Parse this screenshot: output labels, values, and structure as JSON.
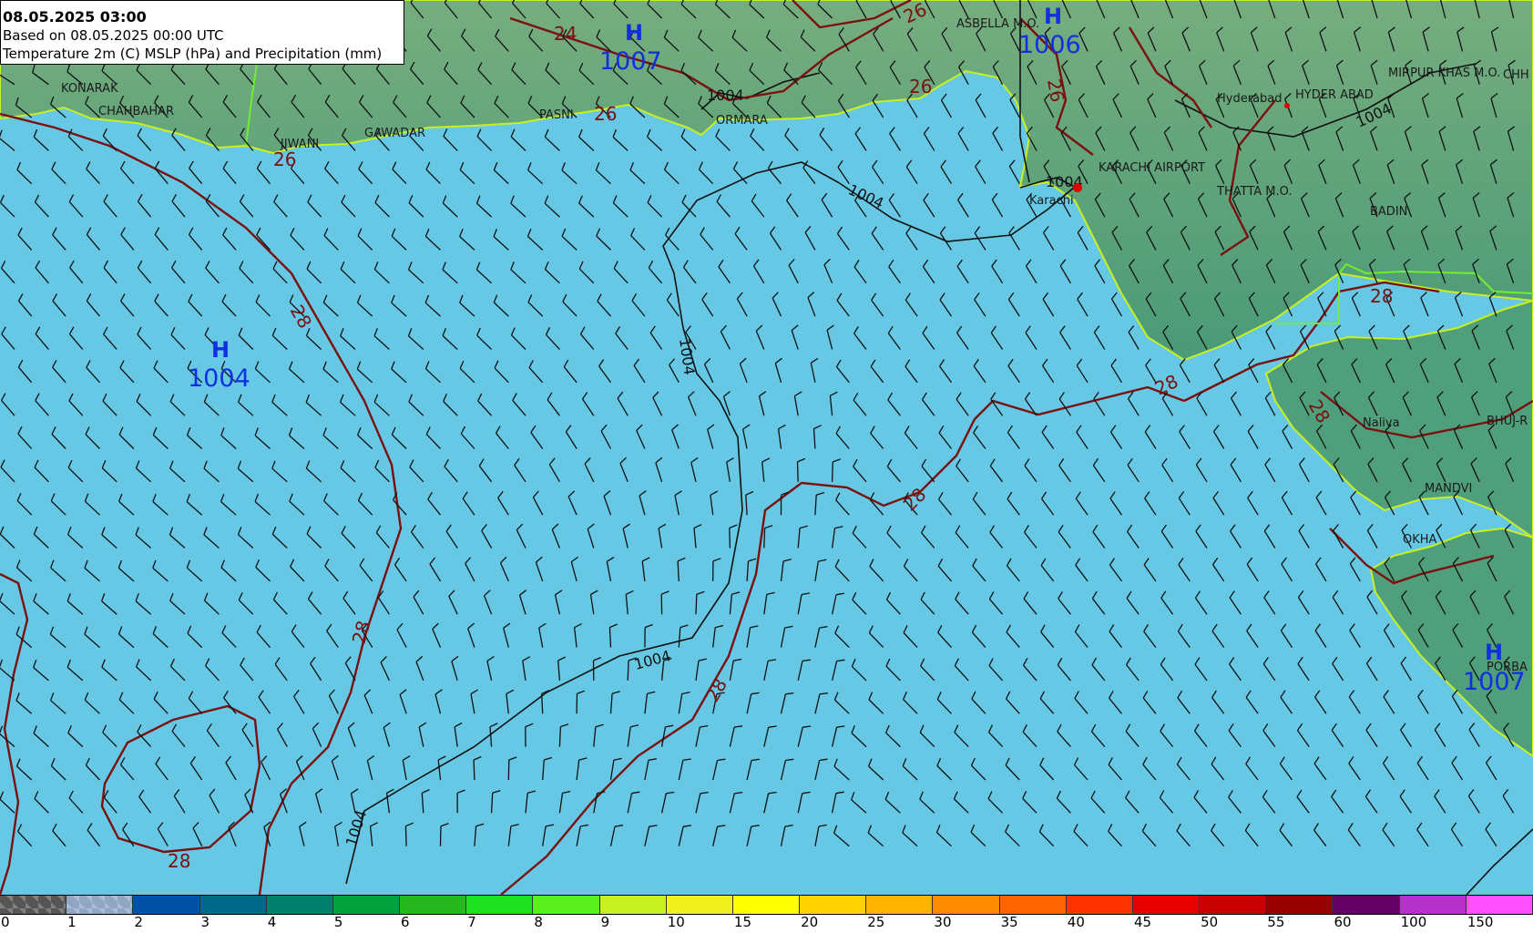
{
  "header": {
    "datetime": "08.05.2025 03:00",
    "based_on": "Based on 08.05.2025 00:00 UTC",
    "parameters": "Temperature 2m (C) MSLP (hPa) and Precipitation (mm)"
  },
  "places": [
    {
      "name": "KONARAK"
    },
    {
      "name": "CHAHBAHAR"
    },
    {
      "name": "JIWANI"
    },
    {
      "name": "GAWADAR"
    },
    {
      "name": "PASNI"
    },
    {
      "name": "ORMARA"
    },
    {
      "name": "ASBELLA M.O."
    },
    {
      "name": "Hyderabad"
    },
    {
      "name": "HYDER ABAD"
    },
    {
      "name": "MIRPUR KHAS M.O."
    },
    {
      "name": "CHH"
    },
    {
      "name": "KARACHI AIRPORT"
    },
    {
      "name": "Karachi"
    },
    {
      "name": "THATTA M.O."
    },
    {
      "name": "BADIN"
    },
    {
      "name": "Naliya"
    },
    {
      "name": "BHUJ-R"
    },
    {
      "name": "MANDVI"
    },
    {
      "name": "OKHA"
    },
    {
      "name": "PORBA"
    }
  ],
  "pressure_centers": [
    {
      "letter": "H",
      "value": "1007"
    },
    {
      "letter": "H",
      "value": "1006"
    },
    {
      "letter": "H",
      "value": "1004"
    },
    {
      "letter": "H",
      "value": "1007"
    }
  ],
  "isobar_labels": [
    "1004",
    "1004",
    "1004",
    "1004",
    "1004",
    "1004",
    "1004"
  ],
  "isotherm_labels": [
    "24",
    "26",
    "26",
    "26",
    "26",
    "26",
    "28",
    "28",
    "28",
    "28",
    "28",
    "28",
    "28",
    "28"
  ],
  "legend": {
    "labels": [
      "0",
      "1",
      "2",
      "3",
      "4",
      "5",
      "6",
      "7",
      "8",
      "9",
      "10",
      "15",
      "20",
      "25",
      "30",
      "35",
      "40",
      "45",
      "50",
      "55",
      "60",
      "100",
      "150"
    ],
    "colors": [
      "#555555",
      "#8fa7c5",
      "#0052a6",
      "#006a8a",
      "#00806a",
      "#00a03c",
      "#26b81e",
      "#1ee01e",
      "#5af01e",
      "#c8f01e",
      "#f0f01e",
      "#ffff00",
      "#ffd200",
      "#ffb400",
      "#ff8c00",
      "#ff6400",
      "#ff3200",
      "#e60000",
      "#c80000",
      "#960000",
      "#640064",
      "#b432c8",
      "#ff50ff"
    ]
  },
  "colors": {
    "sea": "#66c8e4",
    "land": "#4f9e7c",
    "isotherm": "#7a1010",
    "isobar": "#111111",
    "pressure_center": "#1030e0",
    "coast": "#c8f01e"
  }
}
